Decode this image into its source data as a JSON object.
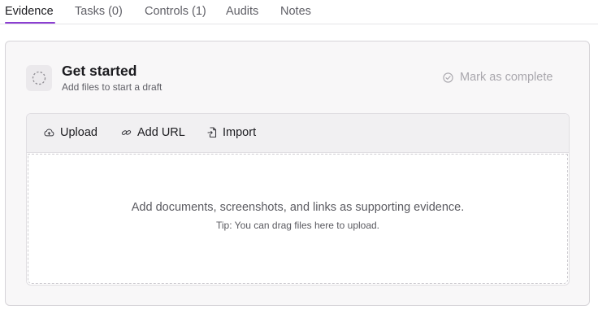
{
  "tabs": [
    {
      "label": "Evidence",
      "active": true
    },
    {
      "label": "Tasks (0)",
      "active": false
    },
    {
      "label": "Controls (1)",
      "active": false
    },
    {
      "label": "Audits",
      "active": false
    },
    {
      "label": "Notes",
      "active": false
    }
  ],
  "card": {
    "title": "Get started",
    "subtitle": "Add files to start a draft",
    "status_icon": "dashed-circle-icon",
    "mark_complete": {
      "label": "Mark as complete",
      "icon": "check-circle-icon"
    }
  },
  "toolbar": {
    "upload": {
      "label": "Upload",
      "icon": "cloud-upload-icon"
    },
    "add_url": {
      "label": "Add URL",
      "icon": "link-icon"
    },
    "import": {
      "label": "Import",
      "icon": "file-import-icon"
    }
  },
  "dropzone": {
    "message": "Add documents, screenshots, and links as supporting evidence.",
    "tip": "Tip: You can drag files here to upload."
  },
  "colors": {
    "accent": "#8b3fd1",
    "text_primary": "#1b1b1f",
    "text_muted": "#5f5f66",
    "disabled": "#a9a7ad",
    "card_bg": "#f8f7f8",
    "toolbar_bg": "#f1f0f2"
  }
}
